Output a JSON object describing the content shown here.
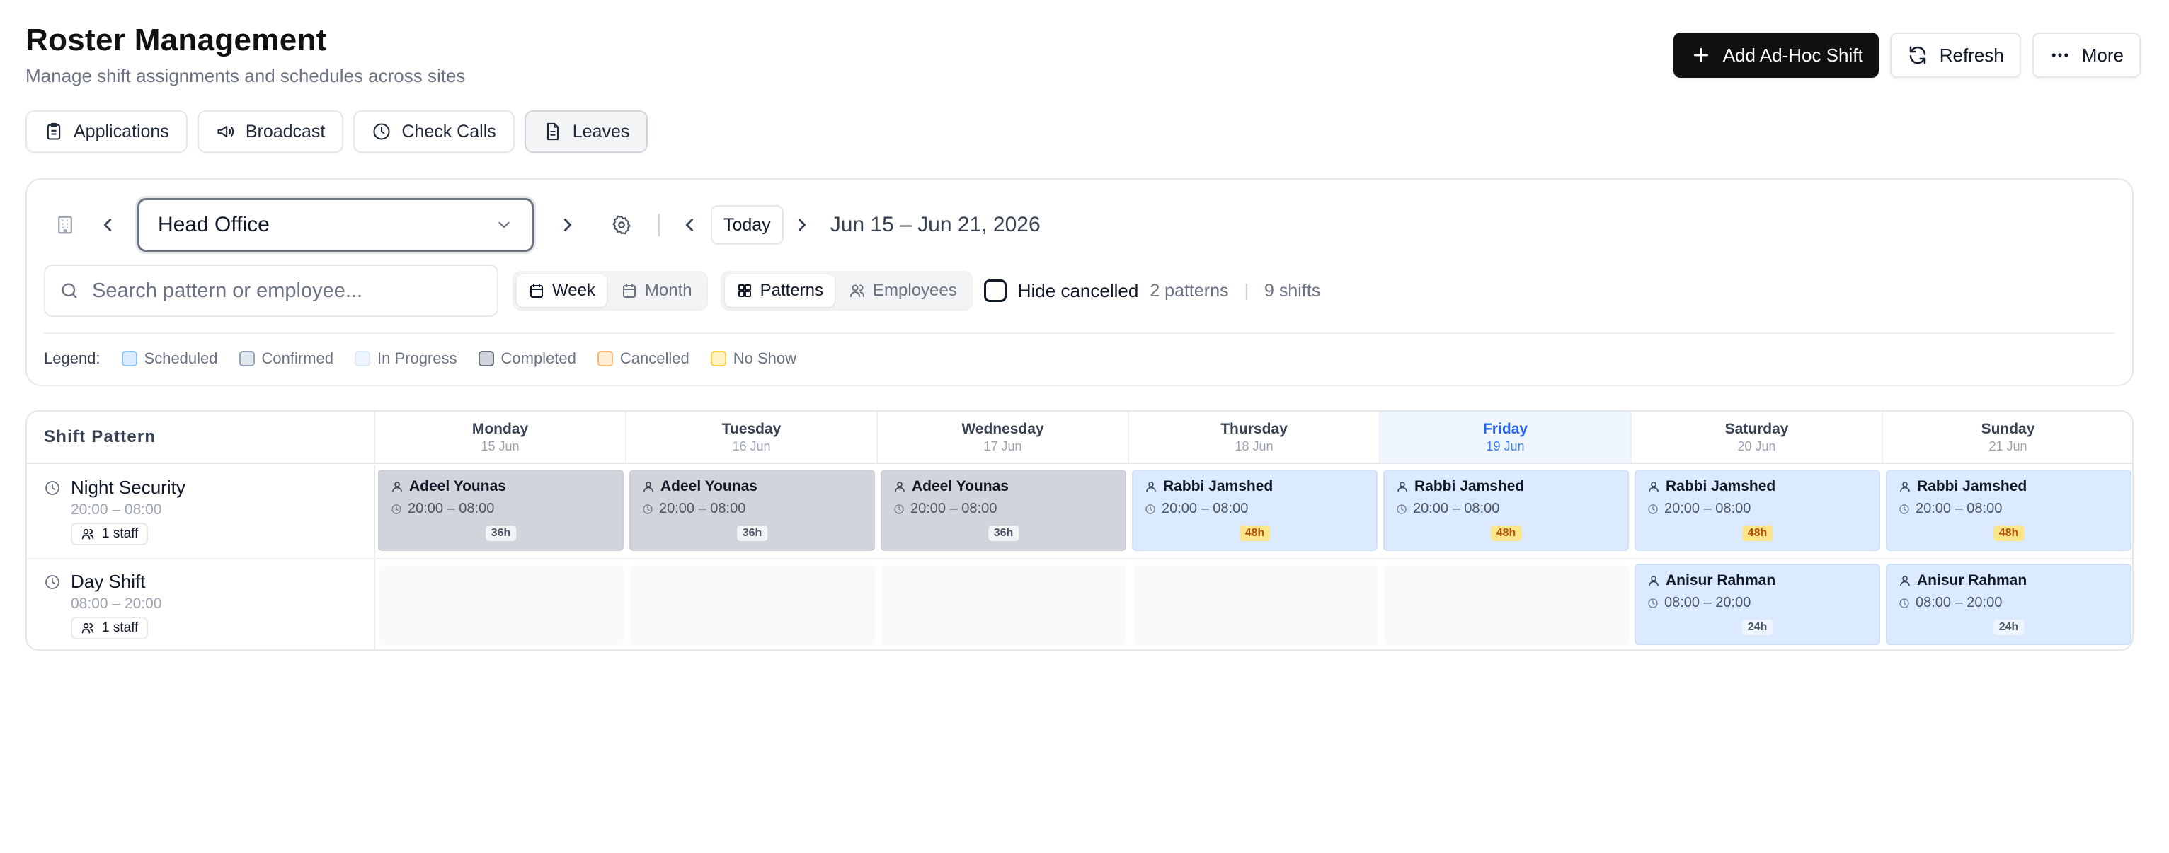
{
  "header": {
    "title": "Roster Management",
    "subtitle": "Manage shift assignments and schedules across sites",
    "add_label": "Add Ad-Hoc Shift",
    "refresh_label": "Refresh",
    "more_label": "More"
  },
  "nav": [
    {
      "label": "Applications",
      "icon": "clipboard-icon"
    },
    {
      "label": "Broadcast",
      "icon": "megaphone-icon"
    },
    {
      "label": "Check Calls",
      "icon": "clock-icon"
    },
    {
      "label": "Leaves",
      "icon": "document-icon",
      "active": true
    }
  ],
  "controls": {
    "site": "Head Office",
    "today_label": "Today",
    "date_range": "Jun 15 – Jun 21, 2026",
    "search_placeholder": "Search pattern or employee...",
    "view_week": "Week",
    "view_month": "Month",
    "mode_patterns": "Patterns",
    "mode_employees": "Employees",
    "hide_cancelled": "Hide cancelled",
    "patterns_count": "2 patterns",
    "divider": "|",
    "shifts_count": "9 shifts"
  },
  "legend": {
    "title": "Legend:",
    "items": [
      {
        "label": "Scheduled",
        "bg": "#dbeafe",
        "border": "#93c5fd"
      },
      {
        "label": "Confirmed",
        "bg": "#e0e7ef",
        "border": "#94a3b8"
      },
      {
        "label": "In Progress",
        "bg": "#eff6ff",
        "border": "#dbeafe"
      },
      {
        "label": "Completed",
        "bg": "#d1d5db",
        "border": "#6b7280"
      },
      {
        "label": "Cancelled",
        "bg": "#ffedd5",
        "border": "#fdba74"
      },
      {
        "label": "No Show",
        "bg": "#fef3c7",
        "border": "#fcd34d"
      }
    ]
  },
  "calendar": {
    "pattern_header": "Shift Pattern",
    "days": [
      {
        "name": "Monday",
        "date": "15 Jun"
      },
      {
        "name": "Tuesday",
        "date": "16 Jun"
      },
      {
        "name": "Wednesday",
        "date": "17 Jun"
      },
      {
        "name": "Thursday",
        "date": "18 Jun"
      },
      {
        "name": "Friday",
        "date": "19 Jun",
        "today": true
      },
      {
        "name": "Saturday",
        "date": "20 Jun"
      },
      {
        "name": "Sunday",
        "date": "21 Jun"
      }
    ],
    "patterns": [
      {
        "name": "Night Security",
        "time": "20:00 – 08:00",
        "staff": "1 staff",
        "shifts": [
          {
            "day": 0,
            "employee": "Adeel Younas",
            "time": "20:00 – 08:00",
            "duration": "36h",
            "status": "completed",
            "badge": "gray"
          },
          {
            "day": 1,
            "employee": "Adeel Younas",
            "time": "20:00 – 08:00",
            "duration": "36h",
            "status": "completed",
            "badge": "gray"
          },
          {
            "day": 2,
            "employee": "Adeel Younas",
            "time": "20:00 – 08:00",
            "duration": "36h",
            "status": "completed",
            "badge": "gray"
          },
          {
            "day": 3,
            "employee": "Rabbi Jamshed",
            "time": "20:00 – 08:00",
            "duration": "48h",
            "status": "scheduled",
            "badge": "amber"
          },
          {
            "day": 4,
            "employee": "Rabbi Jamshed",
            "time": "20:00 – 08:00",
            "duration": "48h",
            "status": "scheduled",
            "badge": "amber"
          },
          {
            "day": 5,
            "employee": "Rabbi Jamshed",
            "time": "20:00 – 08:00",
            "duration": "48h",
            "status": "scheduled",
            "badge": "amber"
          },
          {
            "day": 6,
            "employee": "Rabbi Jamshed",
            "time": "20:00 – 08:00",
            "duration": "48h",
            "status": "scheduled",
            "badge": "amber"
          }
        ]
      },
      {
        "name": "Day Shift",
        "time": "08:00 – 20:00",
        "staff": "1 staff",
        "shifts": [
          {
            "day": 5,
            "employee": "Anisur Rahman",
            "time": "08:00 – 20:00",
            "duration": "24h",
            "status": "scheduled",
            "badge": "blue"
          },
          {
            "day": 6,
            "employee": "Anisur Rahman",
            "time": "08:00 – 20:00",
            "duration": "24h",
            "status": "scheduled",
            "badge": "blue"
          }
        ]
      }
    ]
  }
}
